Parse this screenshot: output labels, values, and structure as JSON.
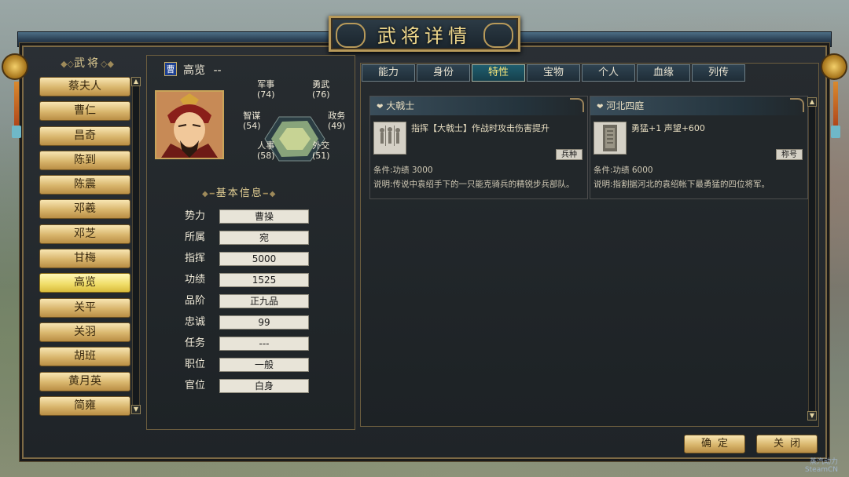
{
  "window": {
    "title": "武将详情"
  },
  "generals_panel": {
    "title": "武将",
    "items": [
      "蔡夫人",
      "曹仁",
      "昌奇",
      "陈到",
      "陈震",
      "邓羲",
      "邓芝",
      "甘梅",
      "高览",
      "关平",
      "关羽",
      "胡班",
      "黄月英",
      "简雍"
    ],
    "selected": "高览"
  },
  "general": {
    "faction": "曹",
    "name": "高览",
    "suffix": "--",
    "stats": {
      "military": {
        "label": "军事",
        "value": "(74)"
      },
      "valor": {
        "label": "勇武",
        "value": "(76)"
      },
      "politics": {
        "label": "政务",
        "value": "(49)"
      },
      "diplomacy": {
        "label": "外交",
        "value": "(51)"
      },
      "personnel": {
        "label": "人事",
        "value": "(58)"
      },
      "strategy": {
        "label": "智谋",
        "value": "(54)"
      }
    }
  },
  "basic_info": {
    "title": "基本信息",
    "rows": [
      {
        "label": "势力",
        "value": "曹操"
      },
      {
        "label": "所属",
        "value": "宛"
      },
      {
        "label": "指挥",
        "value": "5000"
      },
      {
        "label": "功绩",
        "value": "1525"
      },
      {
        "label": "品阶",
        "value": "正九品"
      },
      {
        "label": "忠诚",
        "value": "99"
      },
      {
        "label": "任务",
        "value": "---"
      },
      {
        "label": "职位",
        "value": "一般"
      },
      {
        "label": "官位",
        "value": "白身"
      }
    ]
  },
  "tabs": [
    "能力",
    "身份",
    "特性",
    "宝物",
    "个人",
    "血缘",
    "列传"
  ],
  "active_tab": "特性",
  "traits": [
    {
      "name": "大戟士",
      "effect": "指挥【大戟士】作战时攻击伤害提升",
      "badge": "兵种",
      "condition": "条件:功绩 3000",
      "description": "说明:传说中袁绍手下的一只能克骑兵的精锐步兵部队。",
      "icon": "soldiers-icon"
    },
    {
      "name": "河北四庭",
      "effect": "勇猛+1 声望+600",
      "badge": "称号",
      "condition": "条件:功绩 6000",
      "description": "说明:指割据河北的袁绍帐下最勇猛的四位将军。",
      "icon": "plaque-icon"
    }
  ],
  "buttons": {
    "confirm": "确定",
    "close": "关闭"
  },
  "watermark": {
    "line1": "蒸汽动力",
    "line2": "SteamCN"
  }
}
